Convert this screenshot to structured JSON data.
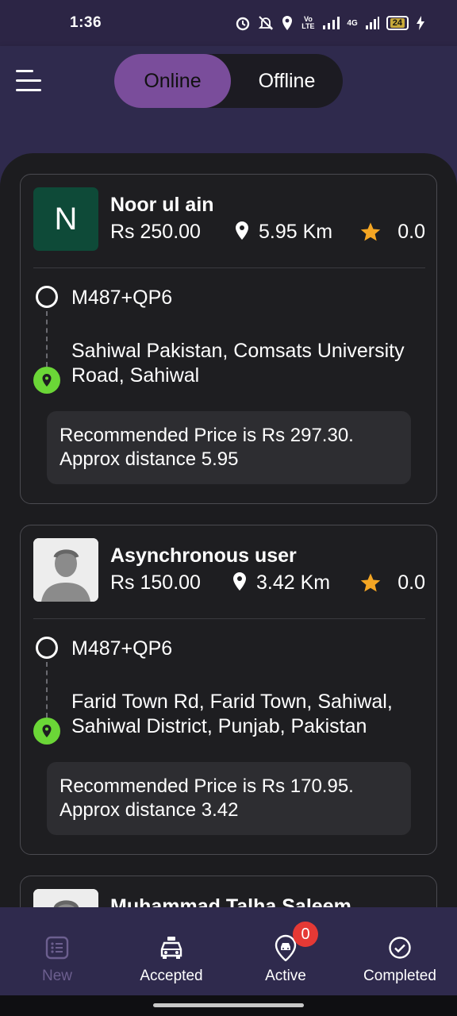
{
  "status_bar": {
    "time": "1:36",
    "network": "4G",
    "volte": "Vo LTE",
    "battery": "24"
  },
  "header": {
    "menu_icon": "hamburger-menu-icon",
    "toggle": {
      "online_label": "Online",
      "offline_label": "Offline",
      "selected": "Online"
    }
  },
  "requests": [
    {
      "avatar_letter": "N",
      "name": "Noor ul ain",
      "price": "Rs 250.00",
      "distance": "5.95 Km",
      "rating": "0.0",
      "pickup": "M487+QP6",
      "dropoff": "Sahiwal Pakistan, Comsats University Road, Sahiwal",
      "recommendation": "Recommended Price is Rs 297.30. Approx distance 5.95"
    },
    {
      "avatar_letter": "",
      "name": "Asynchronous user",
      "price": "Rs 150.00",
      "distance": "3.42 Km",
      "rating": "0.0",
      "pickup": "M487+QP6",
      "dropoff": "Farid Town Rd, Farid Town, Sahiwal, Sahiwal District, Punjab, Pakistan",
      "recommendation": "Recommended Price is Rs 170.95. Approx distance 3.42"
    },
    {
      "avatar_letter": "",
      "name": "Muhammad Talha Saleem"
    }
  ],
  "bottom_nav": {
    "items": [
      {
        "label": "New",
        "icon": "list-icon",
        "active": true
      },
      {
        "label": "Accepted",
        "icon": "taxi-icon"
      },
      {
        "label": "Active",
        "icon": "car-pin-icon",
        "badge": "0"
      },
      {
        "label": "Completed",
        "icon": "check-circle-icon"
      }
    ]
  },
  "colors": {
    "header_bg": "#2f2a4d",
    "toggle_active": "#7a4d9b",
    "panel_bg": "#1c1c1f",
    "pin_green": "#6bd637",
    "star": "#f5a623",
    "badge": "#e53935",
    "avatar_n": "#0e4a38"
  }
}
